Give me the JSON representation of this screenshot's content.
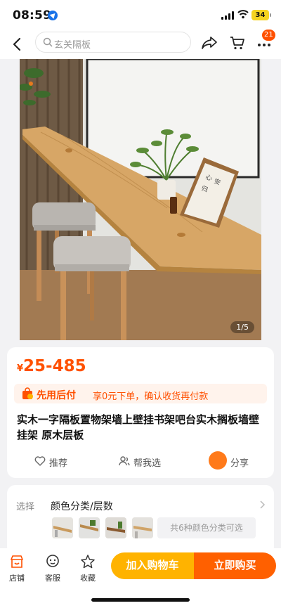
{
  "status_bar": {
    "time": "08:59",
    "battery": "34"
  },
  "nav": {
    "search_placeholder": "玄关隔板",
    "cart_badge": "21"
  },
  "gallery": {
    "pager": "1/5"
  },
  "product": {
    "currency": "¥",
    "price_range": "25-485",
    "bnpl_label": "先用后付",
    "bnpl_desc": "享0元下单，确认收货再付款",
    "title": "实木一字隔板置物架墙上壁挂书架吧台实木搁板墙壁挂架 原木层板",
    "recommend_label": "推荐",
    "help_choose_label": "帮我选",
    "share_label": "分享"
  },
  "selection": {
    "label": "选择",
    "title": "颜色分类/层数",
    "more_text": "共6种颜色分类可选"
  },
  "bottom_bar": {
    "shop_label": "店铺",
    "service_label": "客服",
    "favorite_label": "收藏",
    "add_cart_label": "加入购物车",
    "buy_now_label": "立即购买"
  },
  "colors": {
    "accent": "#ff5000",
    "cart_button": "#ffb300",
    "buy_button": "#ff6000"
  }
}
